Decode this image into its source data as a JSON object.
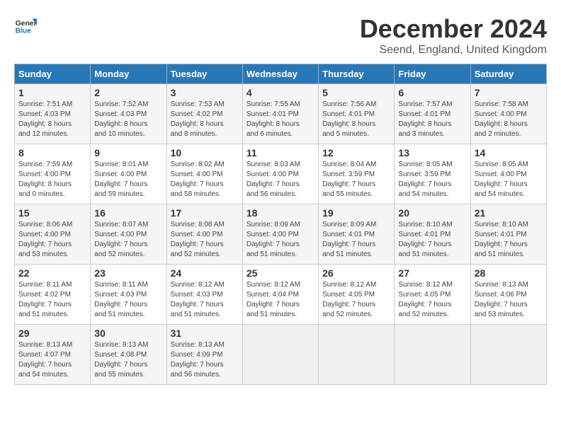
{
  "logo": {
    "line1": "General",
    "line2": "Blue"
  },
  "title": "December 2024",
  "subtitle": "Seend, England, United Kingdom",
  "days_of_week": [
    "Sunday",
    "Monday",
    "Tuesday",
    "Wednesday",
    "Thursday",
    "Friday",
    "Saturday"
  ],
  "weeks": [
    [
      {
        "day": "1",
        "info": "Sunrise: 7:51 AM\nSunset: 4:03 PM\nDaylight: 8 hours\nand 12 minutes."
      },
      {
        "day": "2",
        "info": "Sunrise: 7:52 AM\nSunset: 4:03 PM\nDaylight: 8 hours\nand 10 minutes."
      },
      {
        "day": "3",
        "info": "Sunrise: 7:53 AM\nSunset: 4:02 PM\nDaylight: 8 hours\nand 8 minutes."
      },
      {
        "day": "4",
        "info": "Sunrise: 7:55 AM\nSunset: 4:01 PM\nDaylight: 8 hours\nand 6 minutes."
      },
      {
        "day": "5",
        "info": "Sunrise: 7:56 AM\nSunset: 4:01 PM\nDaylight: 8 hours\nand 5 minutes."
      },
      {
        "day": "6",
        "info": "Sunrise: 7:57 AM\nSunset: 4:01 PM\nDaylight: 8 hours\nand 3 minutes."
      },
      {
        "day": "7",
        "info": "Sunrise: 7:58 AM\nSunset: 4:00 PM\nDaylight: 8 hours\nand 2 minutes."
      }
    ],
    [
      {
        "day": "8",
        "info": "Sunrise: 7:59 AM\nSunset: 4:00 PM\nDaylight: 8 hours\nand 0 minutes."
      },
      {
        "day": "9",
        "info": "Sunrise: 8:01 AM\nSunset: 4:00 PM\nDaylight: 7 hours\nand 59 minutes."
      },
      {
        "day": "10",
        "info": "Sunrise: 8:02 AM\nSunset: 4:00 PM\nDaylight: 7 hours\nand 58 minutes."
      },
      {
        "day": "11",
        "info": "Sunrise: 8:03 AM\nSunset: 4:00 PM\nDaylight: 7 hours\nand 56 minutes."
      },
      {
        "day": "12",
        "info": "Sunrise: 8:04 AM\nSunset: 3:59 PM\nDaylight: 7 hours\nand 55 minutes."
      },
      {
        "day": "13",
        "info": "Sunrise: 8:05 AM\nSunset: 3:59 PM\nDaylight: 7 hours\nand 54 minutes."
      },
      {
        "day": "14",
        "info": "Sunrise: 8:05 AM\nSunset: 4:00 PM\nDaylight: 7 hours\nand 54 minutes."
      }
    ],
    [
      {
        "day": "15",
        "info": "Sunrise: 8:06 AM\nSunset: 4:00 PM\nDaylight: 7 hours\nand 53 minutes."
      },
      {
        "day": "16",
        "info": "Sunrise: 8:07 AM\nSunset: 4:00 PM\nDaylight: 7 hours\nand 52 minutes."
      },
      {
        "day": "17",
        "info": "Sunrise: 8:08 AM\nSunset: 4:00 PM\nDaylight: 7 hours\nand 52 minutes."
      },
      {
        "day": "18",
        "info": "Sunrise: 8:09 AM\nSunset: 4:00 PM\nDaylight: 7 hours\nand 51 minutes."
      },
      {
        "day": "19",
        "info": "Sunrise: 8:09 AM\nSunset: 4:01 PM\nDaylight: 7 hours\nand 51 minutes."
      },
      {
        "day": "20",
        "info": "Sunrise: 8:10 AM\nSunset: 4:01 PM\nDaylight: 7 hours\nand 51 minutes."
      },
      {
        "day": "21",
        "info": "Sunrise: 8:10 AM\nSunset: 4:01 PM\nDaylight: 7 hours\nand 51 minutes."
      }
    ],
    [
      {
        "day": "22",
        "info": "Sunrise: 8:11 AM\nSunset: 4:02 PM\nDaylight: 7 hours\nand 51 minutes."
      },
      {
        "day": "23",
        "info": "Sunrise: 8:11 AM\nSunset: 4:03 PM\nDaylight: 7 hours\nand 51 minutes."
      },
      {
        "day": "24",
        "info": "Sunrise: 8:12 AM\nSunset: 4:03 PM\nDaylight: 7 hours\nand 51 minutes."
      },
      {
        "day": "25",
        "info": "Sunrise: 8:12 AM\nSunset: 4:04 PM\nDaylight: 7 hours\nand 51 minutes."
      },
      {
        "day": "26",
        "info": "Sunrise: 8:12 AM\nSunset: 4:05 PM\nDaylight: 7 hours\nand 52 minutes."
      },
      {
        "day": "27",
        "info": "Sunrise: 8:12 AM\nSunset: 4:05 PM\nDaylight: 7 hours\nand 52 minutes."
      },
      {
        "day": "28",
        "info": "Sunrise: 8:13 AM\nSunset: 4:06 PM\nDaylight: 7 hours\nand 53 minutes."
      }
    ],
    [
      {
        "day": "29",
        "info": "Sunrise: 8:13 AM\nSunset: 4:07 PM\nDaylight: 7 hours\nand 54 minutes."
      },
      {
        "day": "30",
        "info": "Sunrise: 8:13 AM\nSunset: 4:08 PM\nDaylight: 7 hours\nand 55 minutes."
      },
      {
        "day": "31",
        "info": "Sunrise: 8:13 AM\nSunset: 4:09 PM\nDaylight: 7 hours\nand 56 minutes."
      },
      null,
      null,
      null,
      null
    ]
  ]
}
